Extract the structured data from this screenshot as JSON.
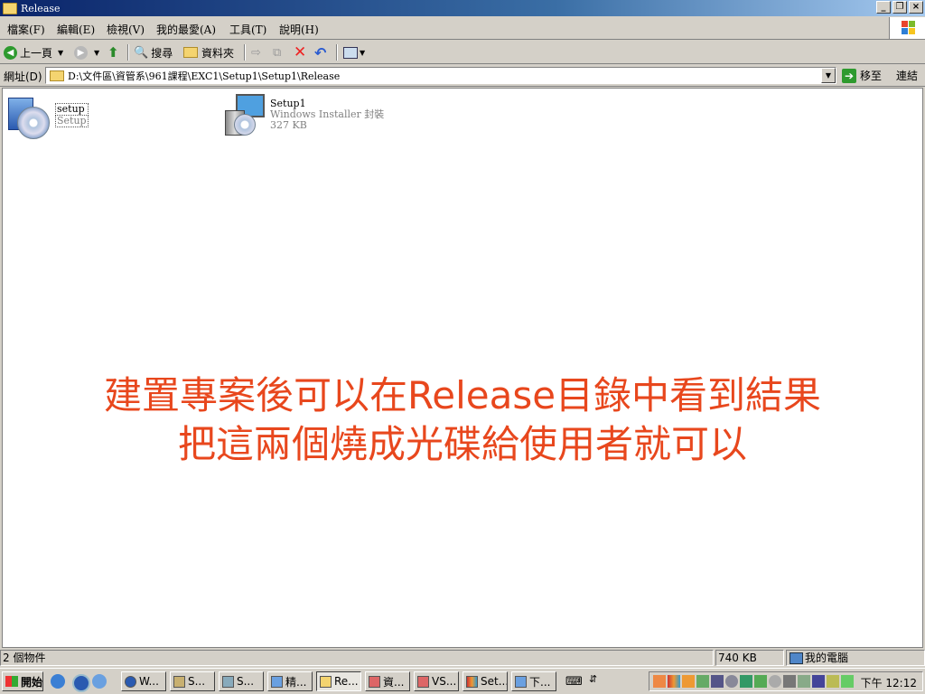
{
  "window": {
    "title": "Release"
  },
  "menu": [
    "檔案(F)",
    "編輯(E)",
    "檢視(V)",
    "我的最愛(A)",
    "工具(T)",
    "說明(H)"
  ],
  "toolbar": {
    "back": "上一頁",
    "search": "搜尋",
    "folders": "資料夾"
  },
  "address": {
    "label": "網址(D)",
    "path": "D:\\文件區\\資管系\\961課程\\EXC1\\Setup1\\Setup1\\Release",
    "go": "移至",
    "links": "連結"
  },
  "files": [
    {
      "name": "setup",
      "type": "Setup",
      "size": ""
    },
    {
      "name": "Setup1",
      "type": "Windows Installer 封裝",
      "size": "327 KB"
    }
  ],
  "overlay": {
    "line1": "建置專案後可以在Release目錄中看到結果",
    "line2": "把這兩個燒成光碟給使用者就可以"
  },
  "status": {
    "count": "2 個物件",
    "size": "740 KB",
    "location": "我的電腦"
  },
  "taskbar": {
    "start": "開始",
    "tasks": [
      "W...",
      "S...",
      "S...",
      "精...",
      "Re...",
      "資...",
      "VS...",
      "Set...",
      "下..."
    ],
    "clock": "下午 12:12"
  },
  "colors": {
    "title_bar": "#0a246a",
    "overlay_text": "#e8471d"
  }
}
